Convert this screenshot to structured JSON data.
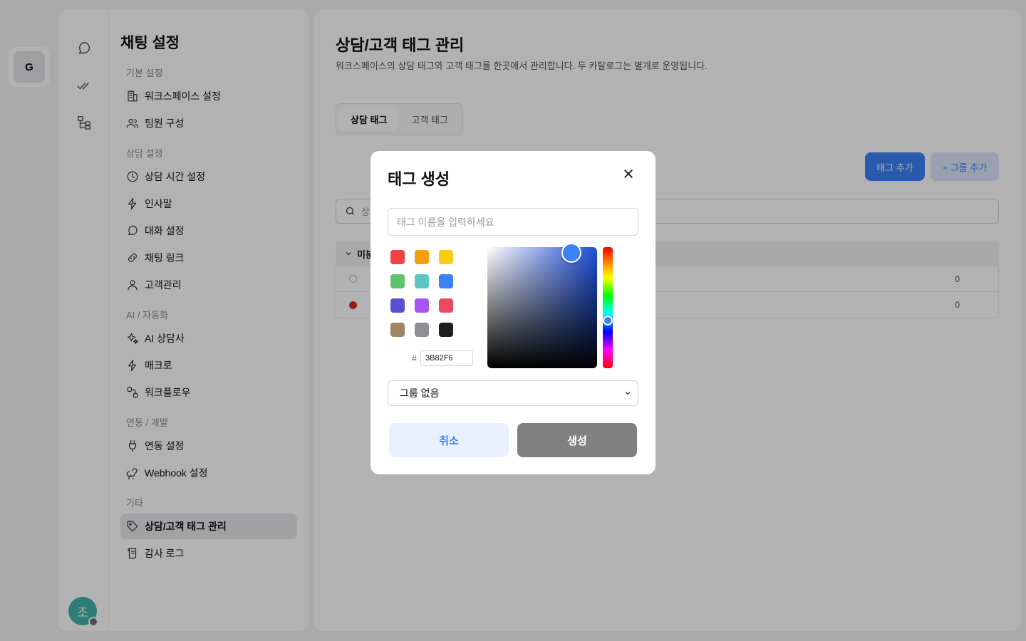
{
  "workspace": {
    "initial": "G"
  },
  "user": {
    "initial": "조"
  },
  "icons": {
    "rail": [
      "chat-bubble-icon",
      "double-check-icon",
      "org-chart-icon"
    ],
    "close": "close-icon"
  },
  "settings_nav": {
    "title": "채팅 설정",
    "sections": [
      {
        "label": "기본 설정",
        "items": [
          {
            "label": "워크스페이스 설정",
            "icon": "building-icon"
          },
          {
            "label": "팀원 구성",
            "icon": "users-icon"
          }
        ]
      },
      {
        "label": "상담 설정",
        "items": [
          {
            "label": "상담 시간 설정",
            "icon": "clock-icon"
          },
          {
            "label": "인사말",
            "icon": "bolt-icon"
          },
          {
            "label": "대화 설정",
            "icon": "chat-bubble-icon"
          },
          {
            "label": "채팅 링크",
            "icon": "link-icon"
          },
          {
            "label": "고객관리",
            "icon": "user-icon"
          }
        ]
      },
      {
        "label": "AI / 자동화",
        "items": [
          {
            "label": "AI 상담사",
            "icon": "sparkles-icon"
          },
          {
            "label": "매크로",
            "icon": "bolt-icon"
          },
          {
            "label": "워크플로우",
            "icon": "workflow-icon"
          }
        ]
      },
      {
        "label": "연동 / 개발",
        "items": [
          {
            "label": "연동 설정",
            "icon": "plug-icon"
          },
          {
            "label": "Webhook 설정",
            "icon": "webhook-icon"
          }
        ]
      },
      {
        "label": "기타",
        "items": [
          {
            "label": "상담/고객 태그 관리",
            "icon": "tag-icon",
            "active": true
          },
          {
            "label": "감사 로그",
            "icon": "scroll-icon"
          }
        ]
      }
    ]
  },
  "main": {
    "title": "상담/고객 태그 관리",
    "description": "워크스페이스의 상담 태그와 고객 태그를 한곳에서 관리합니다. 두 카탈로그는 별개로 운영됩니다.",
    "tabs": [
      {
        "label": "상담 태그",
        "active": true
      },
      {
        "label": "고객 태그",
        "active": false
      }
    ],
    "add_tag_label": "태그 추가",
    "add_group_label": "+ 그룹 추가",
    "search_visible_text": "상",
    "group_row_visible_text": "미분",
    "tag_rows": [
      {
        "color": "#ffffff",
        "count": "0"
      },
      {
        "color": "#dc2626",
        "count": "0"
      }
    ]
  },
  "modal": {
    "title": "태그 생성",
    "name_placeholder": "태그 이름을 입력하세요",
    "swatches": [
      "#ef4444",
      "#f59e0b",
      "#facc15",
      "#5cc46a",
      "#5cc6c0",
      "#3b82f6",
      "#5b50cf",
      "#a855f7",
      "#e84a60",
      "#a08466",
      "#8e8e93",
      "#1f1f1f"
    ],
    "hex_prefix": "#",
    "hex_value": "3B82F6",
    "group_select_value": "그룹 없음",
    "cancel_label": "취소",
    "create_label": "생성"
  }
}
